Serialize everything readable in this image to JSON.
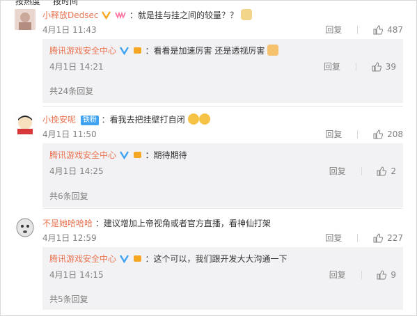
{
  "cut_tabs": [
    "按热度",
    "按时间"
  ],
  "comments": [
    {
      "user": "小释放Dedsec",
      "text": "：就是挂与挂之间的较量？？",
      "time": "4月1日 11:43",
      "reply_label": "回复",
      "likes": "487",
      "reply": {
        "user": "腾讯游戏安全中心",
        "text": "：看看是加速厉害 还是透视厉害",
        "time": "4月1日 14:21",
        "reply_label": "回复",
        "likes": "39"
      },
      "more_replies": "共24条回复"
    },
    {
      "user": "小挽安呢",
      "badge": "铁粉",
      "text": "：看我去把挂壁打自闭",
      "time": "4月1日 11:50",
      "reply_label": "回复",
      "likes": "208",
      "reply": {
        "user": "腾讯游戏安全中心",
        "text": "：期待期待",
        "time": "4月1日 14:25",
        "reply_label": "回复",
        "likes": "2"
      },
      "more_replies": "共6条回复"
    },
    {
      "user": "不是她哈哈哈",
      "text": "：建议增加上帝视角或者官方直播，看神仙打架",
      "time": "4月1日 12:59",
      "reply_label": "回复",
      "likes": "227",
      "reply": {
        "user": "腾讯游戏安全中心",
        "text": "：这个可以，我们跟开发大大沟通一下",
        "time": "4月1日 14:15",
        "reply_label": "回复",
        "likes": "9"
      },
      "more_replies": "共5条回复"
    }
  ],
  "colors": {
    "username": "#eb7350",
    "meta": "#808080",
    "reply_bg": "#f2f2f5",
    "verified": "#3fa3f2"
  }
}
